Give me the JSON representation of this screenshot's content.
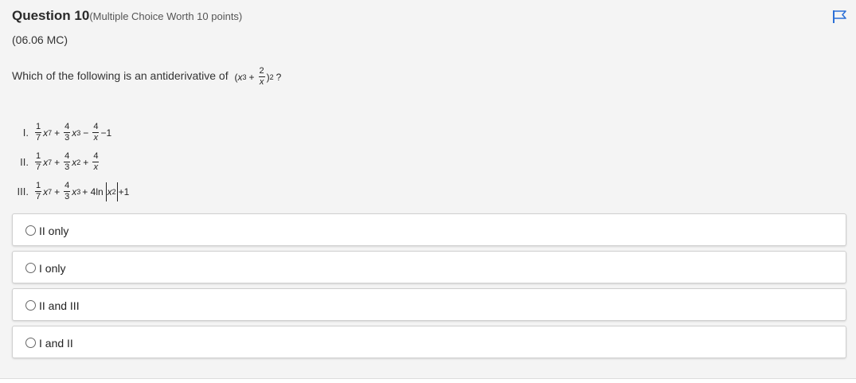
{
  "question": {
    "title": "Question 10",
    "worth": "(Multiple Choice Worth 10 points)",
    "code": "(06.06 MC)",
    "prompt": "Which of the following is an antiderivative of",
    "expression": {
      "x": "x",
      "exp3": "3",
      "plus": "+",
      "num": "2",
      "den": "x",
      "outer_exp": "2",
      "qmark": "?"
    }
  },
  "statements": [
    {
      "numeral": "I.",
      "parts": [
        "1",
        "7",
        "x",
        "7",
        "+",
        "4",
        "3",
        "x",
        "3",
        "−",
        "4",
        "x",
        "−1"
      ]
    },
    {
      "numeral": "II.",
      "parts": [
        "1",
        "7",
        "x",
        "7",
        "+",
        "4",
        "3",
        "x",
        "2",
        "+",
        "4",
        "x"
      ]
    },
    {
      "numeral": "III.",
      "parts": [
        "1",
        "7",
        "x",
        "7",
        "+",
        "4",
        "3",
        "x",
        "3",
        "+ 4ln",
        "x",
        "2",
        "+1"
      ]
    }
  ],
  "options": [
    {
      "label": "II only"
    },
    {
      "label": "I only"
    },
    {
      "label": "II and III"
    },
    {
      "label": "I and II"
    }
  ],
  "colors": {
    "flag": "#2b6fd6",
    "panel": "#f4f4f4"
  },
  "icons": {
    "flag": "flag-icon",
    "radio": "radio-icon"
  }
}
